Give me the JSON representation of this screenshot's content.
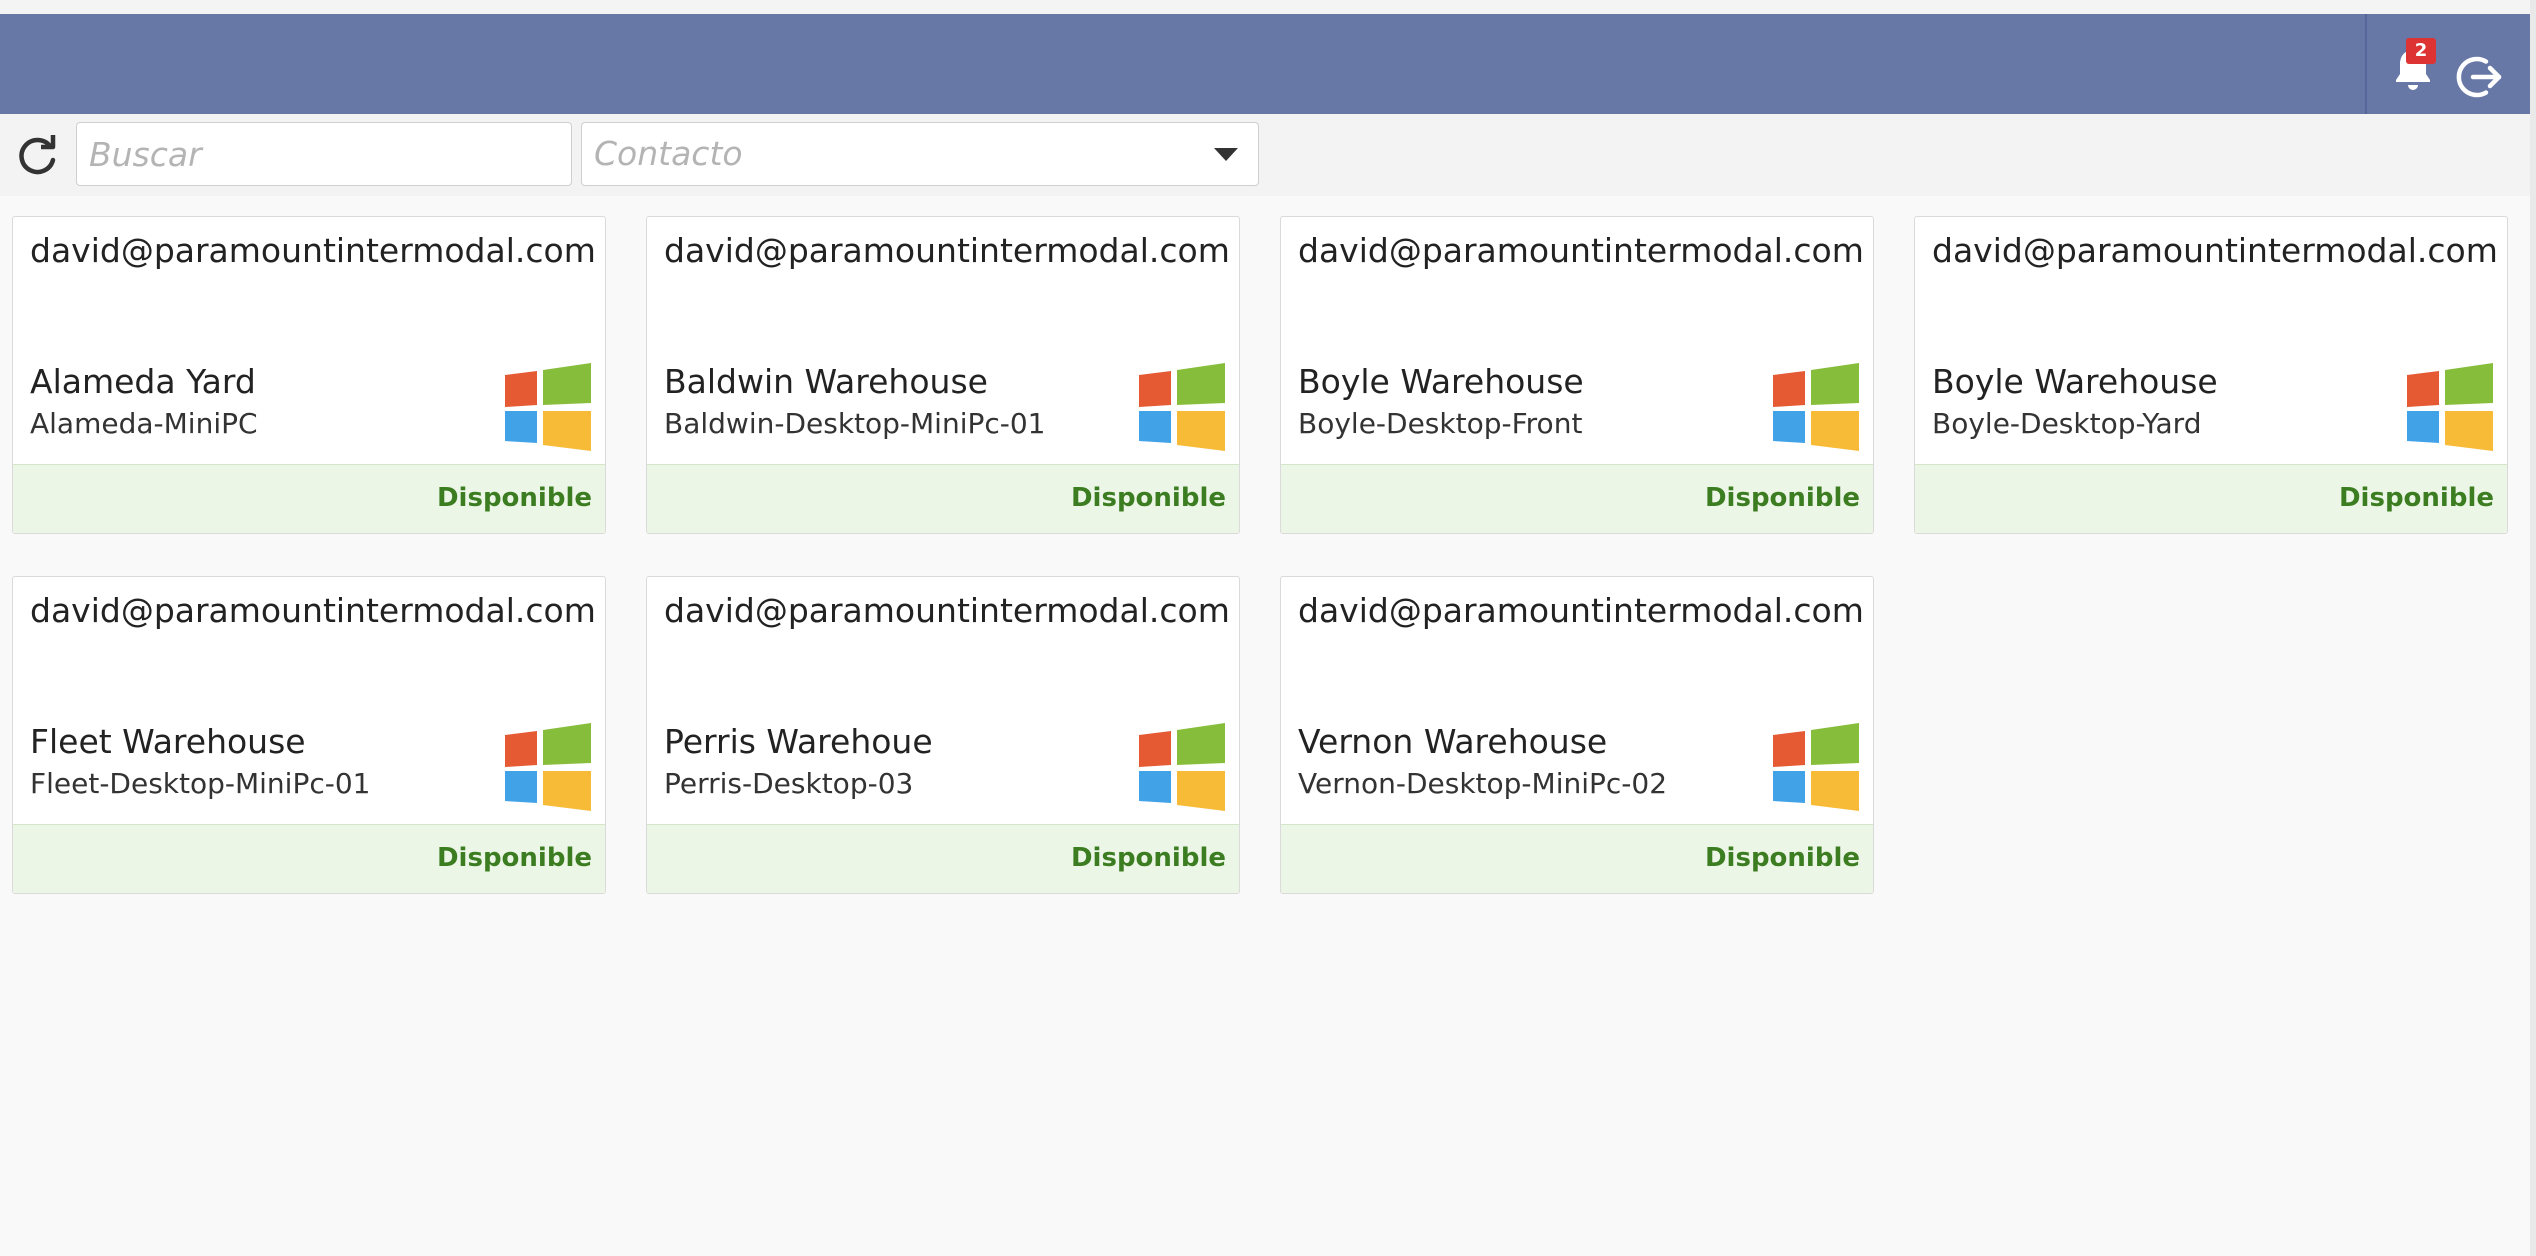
{
  "header": {
    "notifications_count": "2",
    "icons": {
      "notifications": "bell-icon",
      "logout": "logout-icon"
    }
  },
  "toolbar": {
    "search_placeholder": "Buscar",
    "contact_placeholder": "Contacto",
    "icons": {
      "refresh": "refresh-icon",
      "dropdown": "caret-down-icon"
    }
  },
  "colors": {
    "header": "#6878a6",
    "status_text": "#3c7d22",
    "status_bg": "#ecf6e6",
    "windows_red": "#e55a33",
    "windows_green": "#86be3b",
    "windows_blue": "#41a2e8",
    "windows_yellow": "#f7bb38"
  },
  "devices": [
    {
      "email": "david@paramountintermodal.com",
      "name": "Alameda Yard",
      "host": "Alameda-MiniPC",
      "status": "Disponible",
      "os_icon": "windows-icon"
    },
    {
      "email": "david@paramountintermodal.com",
      "name": "Baldwin Warehouse",
      "host": "Baldwin-Desktop-MiniPc-01",
      "status": "Disponible",
      "os_icon": "windows-icon"
    },
    {
      "email": "david@paramountintermodal.com",
      "name": "Boyle Warehouse",
      "host": "Boyle-Desktop-Front",
      "status": "Disponible",
      "os_icon": "windows-icon"
    },
    {
      "email": "david@paramountintermodal.com",
      "name": "Boyle Warehouse",
      "host": "Boyle-Desktop-Yard",
      "status": "Disponible",
      "os_icon": "windows-icon"
    },
    {
      "email": "david@paramountintermodal.com",
      "name": "Fleet Warehouse",
      "host": "Fleet-Desktop-MiniPc-01",
      "status": "Disponible",
      "os_icon": "windows-icon"
    },
    {
      "email": "david@paramountintermodal.com",
      "name": "Perris Warehoue",
      "host": "Perris-Desktop-03",
      "status": "Disponible",
      "os_icon": "windows-icon"
    },
    {
      "email": "david@paramountintermodal.com",
      "name": "Vernon Warehouse",
      "host": "Vernon-Desktop-MiniPc-02",
      "status": "Disponible",
      "os_icon": "windows-icon"
    }
  ]
}
